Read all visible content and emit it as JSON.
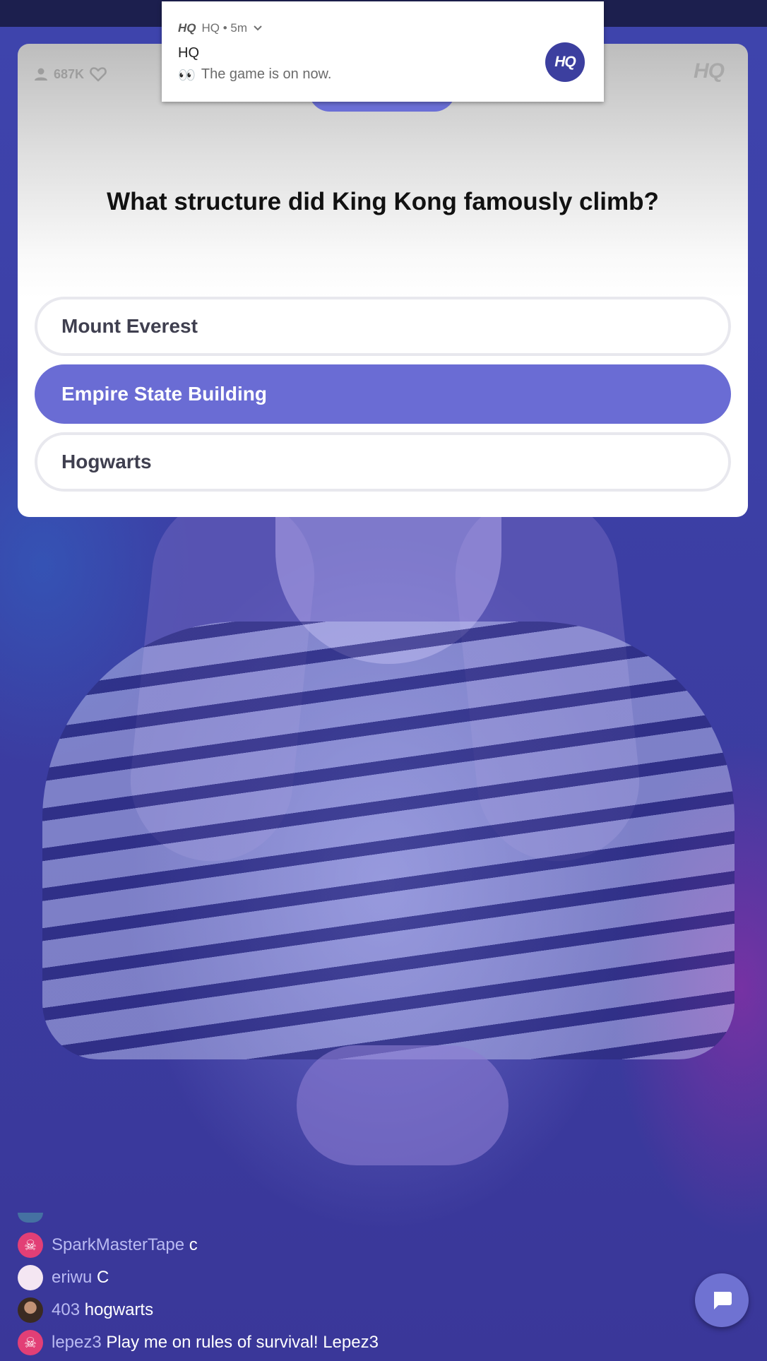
{
  "notification": {
    "app_name": "HQ",
    "meta": "HQ • 5m",
    "title": "HQ",
    "body": "The game is on now.",
    "body_emoji": "👀",
    "avatar_text": "HQ"
  },
  "header": {
    "viewer_count": "687K",
    "logo": "HQ"
  },
  "question": {
    "text": "What structure did King Kong famously climb?",
    "answers": [
      {
        "label": "Mount Everest",
        "selected": false
      },
      {
        "label": "Empire State Building",
        "selected": true
      },
      {
        "label": "Hogwarts",
        "selected": false
      }
    ]
  },
  "chat": {
    "messages": [
      {
        "user": "SparkMasterTape",
        "text": "c",
        "avatar": "skull"
      },
      {
        "user": "eriwu",
        "text": "C",
        "avatar": "blank"
      },
      {
        "user": "403",
        "text": "hogwarts",
        "avatar": "photo"
      },
      {
        "user": "lepez3",
        "text": "Play me on rules of survival! Lepez3",
        "avatar": "skull"
      }
    ]
  },
  "colors": {
    "accent": "#6a6cd4",
    "background": "#3d3fa6",
    "chat_username": "#b9baf2",
    "skull_avatar": "#e23f76"
  }
}
